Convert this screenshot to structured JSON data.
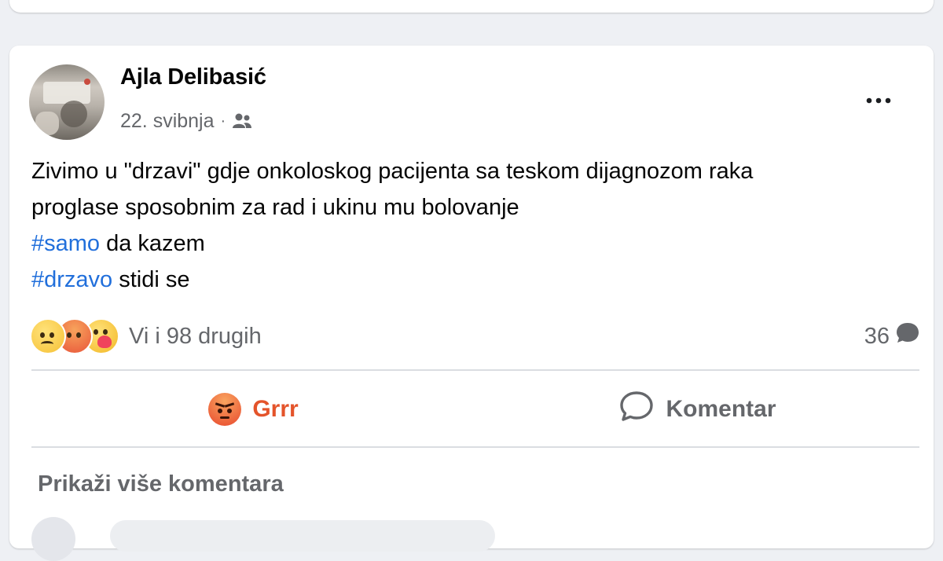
{
  "post": {
    "author": "Ajla Delibasić",
    "date": "22. svibnja",
    "separator": "·",
    "audience_icon": "friends-icon",
    "body": {
      "line1": "Zivimo u \"drzavi\" gdje onkoloskog pacijenta sa teskom dijagnozom raka",
      "line2": "proglase sposobnim za rad i ukinu mu bolovanje",
      "line3_hashtag": "#samo",
      "line3_text": " da kazem",
      "line4_hashtag": "#drzavo",
      "line4_text": " stidi se"
    },
    "reactions": {
      "icons": [
        "sad-reaction-icon",
        "angry-reaction-icon",
        "care-reaction-icon"
      ],
      "summary": "Vi i 98 drugih"
    },
    "comment_count": "36",
    "actions": {
      "react_label": "Grrr",
      "comment_label": "Komentar"
    },
    "more_comments_label": "Prikaži više komentara"
  },
  "colors": {
    "hashtag": "#216fdb",
    "grrr": "#e4542b",
    "secondary_text": "#65676b",
    "page_background": "#eef0f4"
  }
}
